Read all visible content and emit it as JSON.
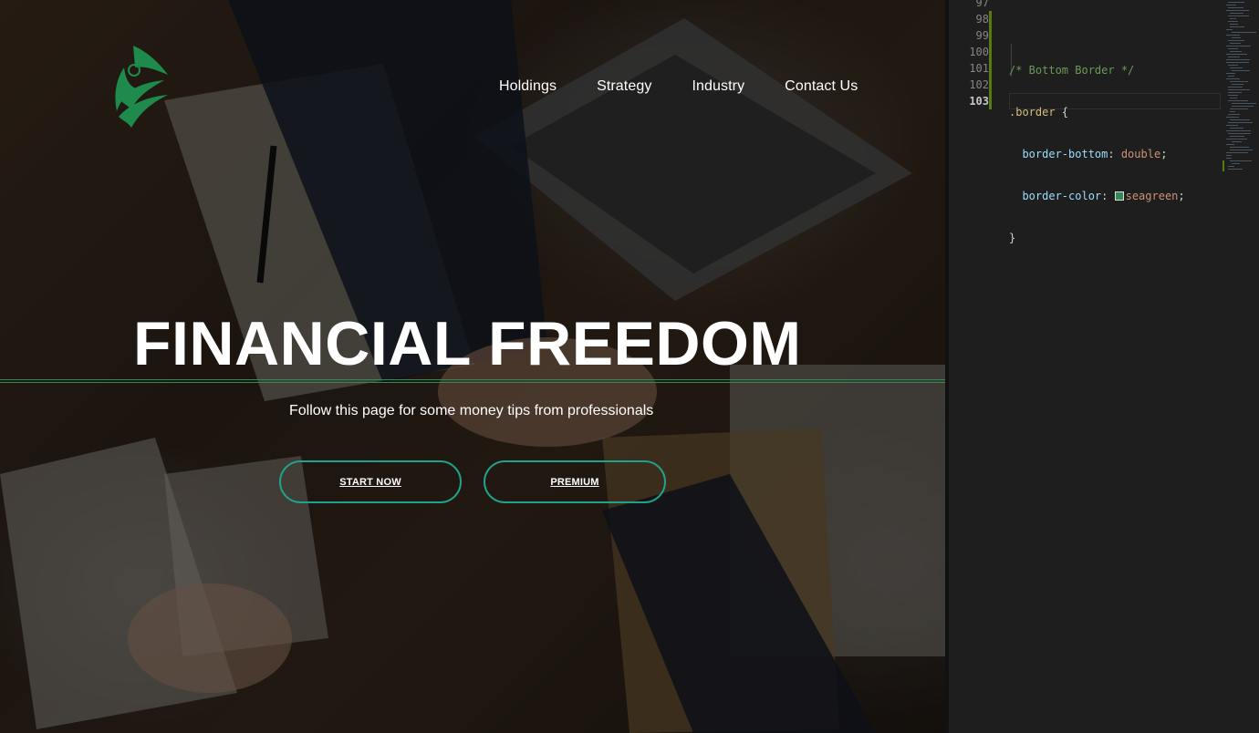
{
  "website": {
    "nav": [
      "Holdings",
      "Strategy",
      "Industry",
      "Contact Us"
    ],
    "hero_title": "FINANCIAL FREEDOM",
    "hero_subtitle": "Follow this page for some money tips from professionals",
    "buttons": {
      "start": "START NOW",
      "premium": "PREMIUM"
    },
    "colors": {
      "accent": "#1fa38c",
      "border": "#2e8b57",
      "logo": "#1e8a4c"
    }
  },
  "editor": {
    "line_numbers": [
      "97",
      "98",
      "99",
      "100",
      "101",
      "102",
      "103"
    ],
    "active_line": "103",
    "code": {
      "comment": "/* Bottom Border */",
      "selector": ".border",
      "open_brace": " {",
      "prop1": "border-bottom",
      "val1": "double",
      "prop2": "border-color",
      "val2": "seagreen",
      "close_brace": "}",
      "swatch_color": "#2e8b57"
    }
  }
}
